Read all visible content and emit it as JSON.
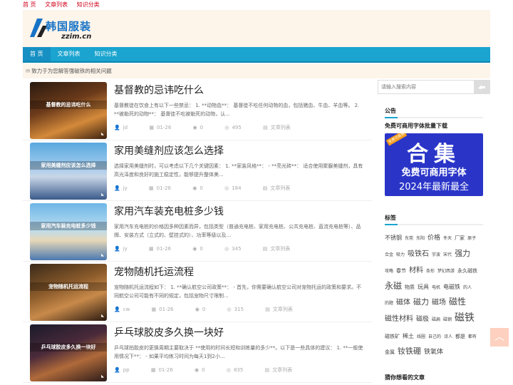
{
  "topbar": {
    "links": [
      "首 页",
      "文章列表",
      "知识分类"
    ]
  },
  "logo": {
    "title": "韩国服装",
    "subtitle": "zzim.cn"
  },
  "nav": {
    "items": [
      "首 页",
      "文章列表",
      "知识分类"
    ]
  },
  "notice": {
    "text": "致力于为您解答强磁铁的相关问题"
  },
  "posts": [
    {
      "thumb_label": "基督教的忌讳吃什么",
      "title": "基督教的忌讳吃什么",
      "excerpt": "基督教徒在饮食上有以下一些禁忌： 1. **动物血**： 基督徒不吃任何动物的血，包括猪血、牛血、羊血等。 2. **被勒死的动物**： 基督徒不吃被勒死的动物，认...",
      "author": "jd",
      "date": "01-26",
      "comments": "0",
      "views": "495",
      "category": "文章列表"
    },
    {
      "thumb_label": "家用美缝剂应该怎么选择",
      "title": "家用美缝剂应该怎么选择",
      "excerpt": "选择家用美缝剂时，可以考虑以下几个关键因素： 1. **家装风格**： - **亮光砖**： 适合使用聚脲美缝剂，具有高光泽度和良好的施工稳定性，能够提升整体美...",
      "author": "jy",
      "date": "01-26",
      "comments": "0",
      "views": "184",
      "category": "文章列表"
    },
    {
      "thumb_label": "家用汽车装充电桩多少钱",
      "title": "家用汽车装充电桩多少钱",
      "excerpt": "家用汽车充电桩的价格因多种因素而异，包括类型（普通充电桩、家用充电桩、公共充电桩、直流充电桩等）、品牌、安装方式（立式的、壁挂式的）、功率等级以及...",
      "author": "jy",
      "date": "01-26",
      "comments": "0",
      "views": "345",
      "category": "文章列表"
    },
    {
      "thumb_label": "宠物随机托运流程",
      "title": "宠物随机托运流程",
      "excerpt": "宠物随机托运流程如下： 1. **确认航空公司政策**： - 首先，你需要确认航空公司对宠物托运的政策和要求。不同航空公司可能有不同的规定，包括宠物尺寸限制...",
      "author": "cw",
      "date": "01-26",
      "comments": "0",
      "views": "315",
      "category": "文章列表"
    },
    {
      "thumb_label": "乒乓球胶皮多久换一块好",
      "title": "乒乓球胶皮多久换一块好",
      "excerpt": "乒乓球拍胶皮的更换周期主要取决于 **使用的时间长短和训练量的多少**。以下是一些具体的建议： 1. **一般使用情况下**： - 如果平均练习时间为每天1到2小...",
      "author": "pp",
      "date": "01-26",
      "comments": "0",
      "views": "835",
      "category": "文章列表"
    }
  ],
  "sidebar": {
    "search_placeholder": "请输入搜索内容",
    "announcement_title": "公告",
    "promo_title": "免费可商用字体批量下载",
    "promo": {
      "tag": "免费可商用",
      "big": "合集",
      "mid": "免费可商用字体",
      "small": "2024年最新最全"
    },
    "tags_title": "标签",
    "tags": [
      {
        "t": "不锈钢",
        "s": 8
      },
      {
        "t": "东莞",
        "s": 6
      },
      {
        "t": "东阳",
        "s": 6
      },
      {
        "t": "价格",
        "s": 9
      },
      {
        "t": "冬天",
        "s": 6
      },
      {
        "t": "厂家",
        "s": 7
      },
      {
        "t": "原子",
        "s": 6
      },
      {
        "t": "合金",
        "s": 6
      },
      {
        "t": "吸力",
        "s": 6
      },
      {
        "t": "吸铁石",
        "s": 10
      },
      {
        "t": "宇波",
        "s": 6
      },
      {
        "t": "宋代",
        "s": 6
      },
      {
        "t": "强力",
        "s": 11
      },
      {
        "t": "攻略",
        "s": 6
      },
      {
        "t": "春节",
        "s": 7
      },
      {
        "t": "材料",
        "s": 10
      },
      {
        "t": "条形",
        "s": 6
      },
      {
        "t": "梦幻西游",
        "s": 6
      },
      {
        "t": "永久磁铁",
        "s": 7
      },
      {
        "t": "永磁",
        "s": 12
      },
      {
        "t": "物质",
        "s": 7
      },
      {
        "t": "玩具",
        "s": 8
      },
      {
        "t": "电机",
        "s": 6
      },
      {
        "t": "电磁铁",
        "s": 8
      },
      {
        "t": "的人",
        "s": 6
      },
      {
        "t": "的题",
        "s": 6
      },
      {
        "t": "磁体",
        "s": 10
      },
      {
        "t": "磁力",
        "s": 11
      },
      {
        "t": "磁场",
        "s": 10
      },
      {
        "t": "磁性",
        "s": 12
      },
      {
        "t": "磁性材料",
        "s": 10
      },
      {
        "t": "磁极",
        "s": 9
      },
      {
        "t": "磁扁",
        "s": 6
      },
      {
        "t": "磁钢",
        "s": 6
      },
      {
        "t": "磁铁",
        "s": 14
      },
      {
        "t": "磁铁矿",
        "s": 7
      },
      {
        "t": "稀土",
        "s": 8
      },
      {
        "t": "线圈",
        "s": 6
      },
      {
        "t": "自己的",
        "s": 6
      },
      {
        "t": "诗人",
        "s": 6
      },
      {
        "t": "都是",
        "s": 7
      },
      {
        "t": "都有",
        "s": 6
      },
      {
        "t": "金属",
        "s": 7
      },
      {
        "t": "钕铁硼",
        "s": 11
      },
      {
        "t": "铁氧体",
        "s": 9
      }
    ],
    "related_title": "猜你想看的文章"
  },
  "colors": {
    "accent": "#1aa4cf",
    "topbar_link": "#d0021b",
    "header_bg": "#fdf4ea"
  }
}
